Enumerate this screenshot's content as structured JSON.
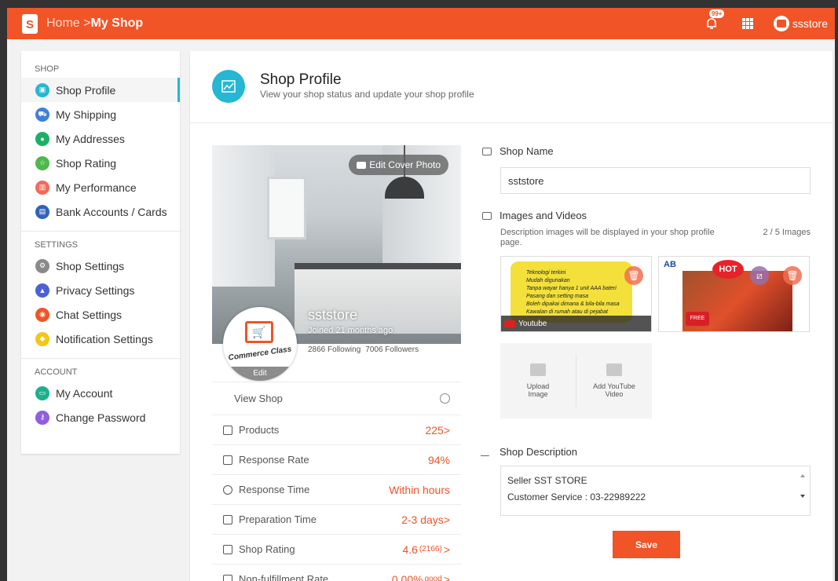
{
  "topbar": {
    "home": "Home",
    "separator": " >",
    "current": "My Shop",
    "notif_badge": "99+",
    "username": "ssstore"
  },
  "sidebar": {
    "sections": [
      {
        "title": "SHOP",
        "items": [
          "Shop Profile",
          "My Shipping",
          "My Addresses",
          "Shop Rating",
          "My Performance",
          "Bank Accounts / Cards"
        ]
      },
      {
        "title": "SETTINGS",
        "items": [
          "Shop Settings",
          "Privacy Settings",
          "Chat Settings",
          "Notification Settings"
        ]
      },
      {
        "title": "ACCOUNT",
        "items": [
          "My Account",
          "Change Password"
        ]
      }
    ]
  },
  "page": {
    "title": "Shop Profile",
    "subtitle": "View your shop status and update your shop profile"
  },
  "cover": {
    "edit_label": "Edit Cover Photo",
    "shop_name": "sststore",
    "joined": "Joined 21 months ago",
    "following": "2866 Following",
    "followers": "7006 Followers",
    "logo_text": "Commerce Class",
    "edit_logo": "Edit"
  },
  "stats": {
    "view_shop": "View Shop",
    "rows": [
      {
        "label": "Products",
        "value": "225",
        "arrow": ">"
      },
      {
        "label": "Response Rate",
        "value": "94%",
        "arrow": ""
      },
      {
        "label": "Response Time",
        "value": "Within hours",
        "arrow": ""
      },
      {
        "label": "Preparation Time",
        "value": "2-3 days",
        "arrow": ">"
      },
      {
        "label": "Shop Rating",
        "value": "4.6",
        "extra": "(2166)",
        "arrow": ">"
      },
      {
        "label": "Non-fulfillment Rate",
        "value": "0.00%",
        "extra": "good",
        "arrow": ">"
      }
    ]
  },
  "form": {
    "shop_name_label": "Shop Name",
    "shop_name_value": "sststore",
    "images_label": "Images and Videos",
    "images_desc": "Description images will be displayed in your shop profile page.",
    "images_count": "2 / 5 Images",
    "youtube_label": "Youtube",
    "upload_image": "Upload Image",
    "add_youtube": "Add YouTube Video",
    "description_label": "Shop Description",
    "description_line1": "Seller SST STORE",
    "description_line2": "Customer Service : 03-22989222",
    "save_label": "Save"
  },
  "thumb1": {
    "lines": [
      "Teknologi terkini",
      "Mudah digunakan",
      "Tanpa wayar hanya 1 unit AAA bateri",
      "Pasang dan setting masa",
      "Boleh dipakai dimana & bila-bila masa",
      "Kawalan di rumah atau di pejabat"
    ]
  },
  "thumb2": {
    "hot": "HOT",
    "brand": "AB",
    "free": "FREE"
  },
  "colors": {
    "brand": "#f05427",
    "accent": "#25b7d3"
  }
}
